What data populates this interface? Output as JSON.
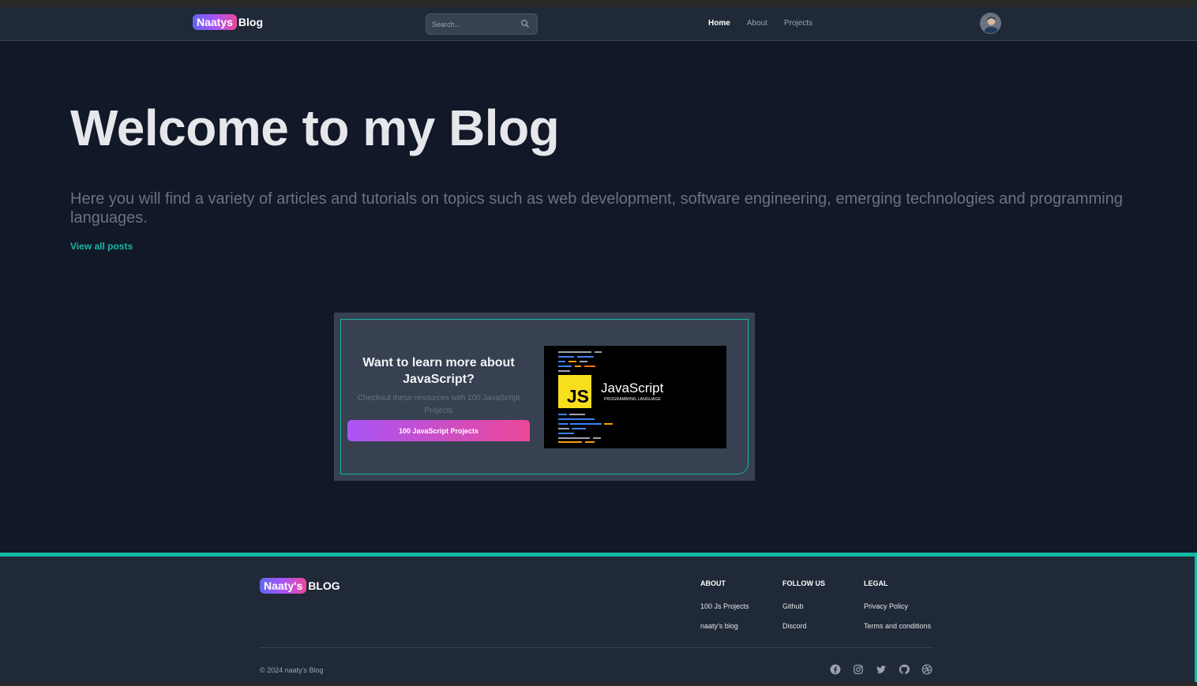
{
  "navbar": {
    "brand_pill": "Naatys",
    "brand_text": "Blog",
    "search_placeholder": "Search...",
    "links": [
      {
        "label": "Home",
        "active": true
      },
      {
        "label": "About",
        "active": false
      },
      {
        "label": "Projects",
        "active": false
      }
    ],
    "avatar_icon": "user-avatar"
  },
  "hero": {
    "title": "Welcome to my Blog",
    "description": "Here you will find a variety of articles and tutorials on topics such as web development, software engineering, emerging technologies and programming languages.",
    "link_label": "View all posts"
  },
  "promo": {
    "heading": "Want to learn more about JavaScript?",
    "subtext": "Checkout these resources with 100 JavaScript Projects",
    "button_label": "100 JavaScript Projects",
    "image": {
      "logo_text": "JS",
      "title": "JavaScript",
      "subtitle": "PROGRAMMING LANGUAGE"
    }
  },
  "footer": {
    "brand_pill": "Naaty's",
    "brand_text": "BLOG",
    "columns": [
      {
        "title": "About",
        "links": [
          "100 Js Projects",
          "naaty's blog"
        ]
      },
      {
        "title": "Follow us",
        "links": [
          "Github",
          "Discord"
        ]
      },
      {
        "title": "Legal",
        "links": [
          "Privacy Policy",
          "Terms and conditions"
        ]
      }
    ],
    "copyright": "© 2024 naaty's Blog",
    "socials": [
      "facebook-icon",
      "instagram-icon",
      "twitter-icon",
      "github-icon",
      "dribbble-icon"
    ]
  },
  "colors": {
    "background": "#111827",
    "surface": "#1f2937",
    "accent": "#14b8a6",
    "gradient_start": "#a855f7",
    "gradient_end": "#ec4899"
  }
}
